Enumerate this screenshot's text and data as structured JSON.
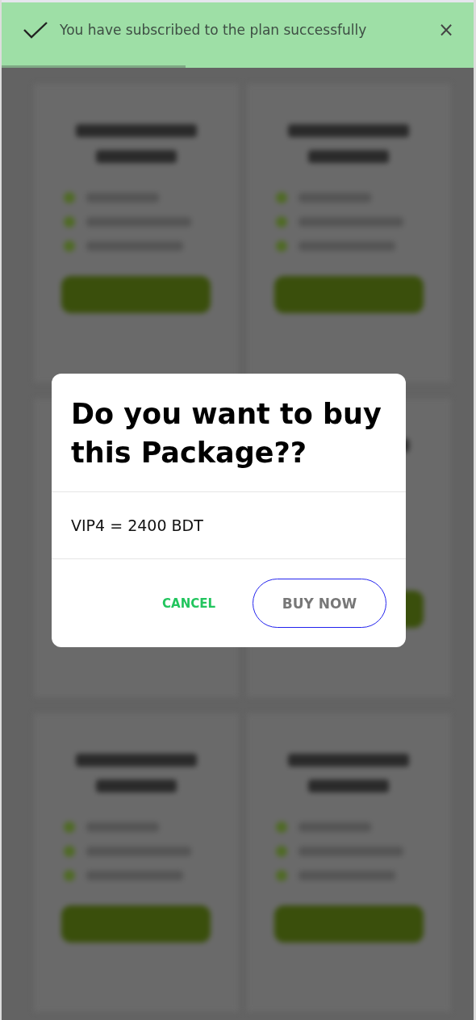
{
  "toast": {
    "message": "You have subscribed to the plan successfully",
    "close": "×",
    "progress": {
      "level": 0.39
    }
  },
  "dialog": {
    "title": "Do you want to buy this Package??",
    "body": "VIP4 = 2400 BDT",
    "buttons": [
      {
        "kind": "text",
        "label": "CANCEL"
      },
      {
        "kind": "outlined",
        "label": "BUY NOW"
      }
    ]
  }
}
